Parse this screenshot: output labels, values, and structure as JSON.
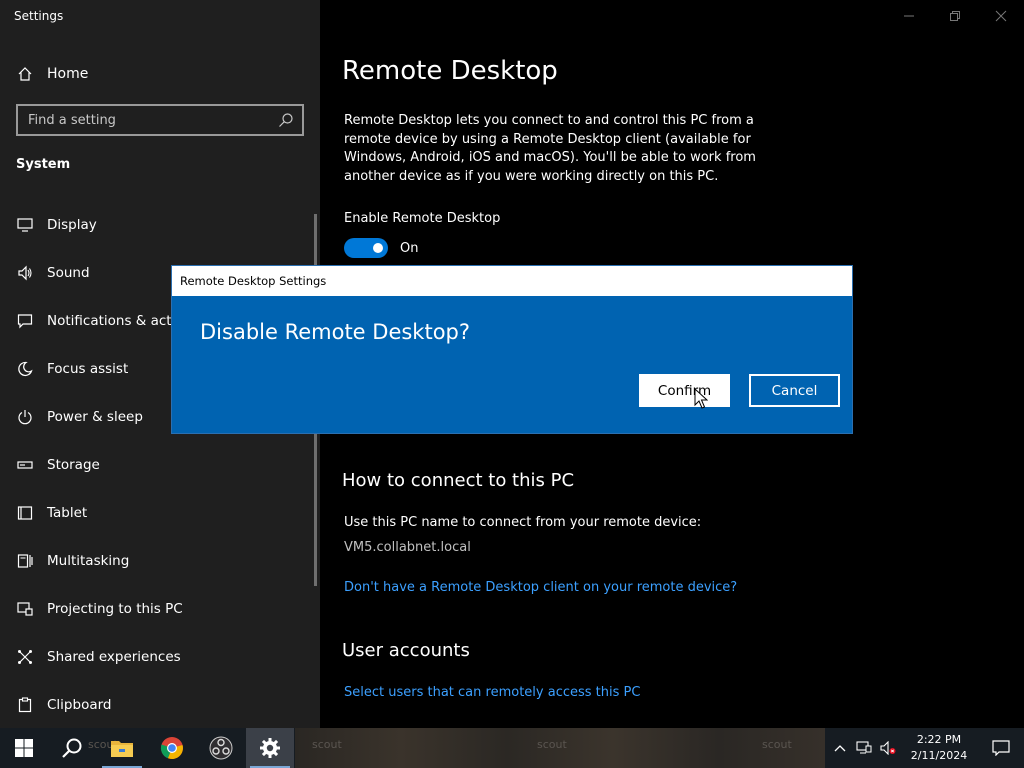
{
  "window": {
    "app_title": "Settings",
    "controls": [
      "minimize",
      "restore",
      "close"
    ]
  },
  "sidebar": {
    "home_label": "Home",
    "search_placeholder": "Find a setting",
    "section_title": "System",
    "items": [
      {
        "label": "Display",
        "icon": "display-icon"
      },
      {
        "label": "Sound",
        "icon": "sound-icon"
      },
      {
        "label": "Notifications & actions",
        "icon": "notifications-icon"
      },
      {
        "label": "Focus assist",
        "icon": "moon-icon"
      },
      {
        "label": "Power & sleep",
        "icon": "power-icon"
      },
      {
        "label": "Storage",
        "icon": "storage-icon"
      },
      {
        "label": "Tablet",
        "icon": "tablet-icon"
      },
      {
        "label": "Multitasking",
        "icon": "multitasking-icon"
      },
      {
        "label": "Projecting to this PC",
        "icon": "projecting-icon"
      },
      {
        "label": "Shared experiences",
        "icon": "shared-icon"
      },
      {
        "label": "Clipboard",
        "icon": "clipboard-icon"
      }
    ]
  },
  "main": {
    "title": "Remote Desktop",
    "description": "Remote Desktop lets you connect to and control this PC from a remote device by using a Remote Desktop client (available for Windows, Android, iOS and macOS). You'll be able to work from another device as if you were working directly on this PC.",
    "enable_label": "Enable Remote Desktop",
    "toggle_state": "On",
    "how_to_heading": "How to connect to this PC",
    "how_to_text": "Use this PC name to connect from your remote device:",
    "pc_name": "VM5.collabnet.local",
    "client_link": "Don't have a Remote Desktop client on your remote device?",
    "user_accounts_heading": "User accounts",
    "users_link": "Select users that can remotely access this PC"
  },
  "dialog": {
    "title": "Remote Desktop Settings",
    "heading": "Disable Remote Desktop?",
    "confirm_label": "Confirm",
    "cancel_label": "Cancel"
  },
  "taskbar": {
    "apps": [
      "windows-start",
      "search",
      "file-explorer",
      "chrome",
      "obs",
      "settings"
    ],
    "ghost_labels": [
      "scout",
      "scout",
      "scout",
      "scout"
    ],
    "clock_time": "2:22 PM",
    "clock_date": "2/11/2024"
  },
  "colors": {
    "accent": "#0078d7",
    "dialog_bg": "#0063b1",
    "link": "#3ca0ff",
    "sidebar_bg": "#1f1f1f"
  }
}
